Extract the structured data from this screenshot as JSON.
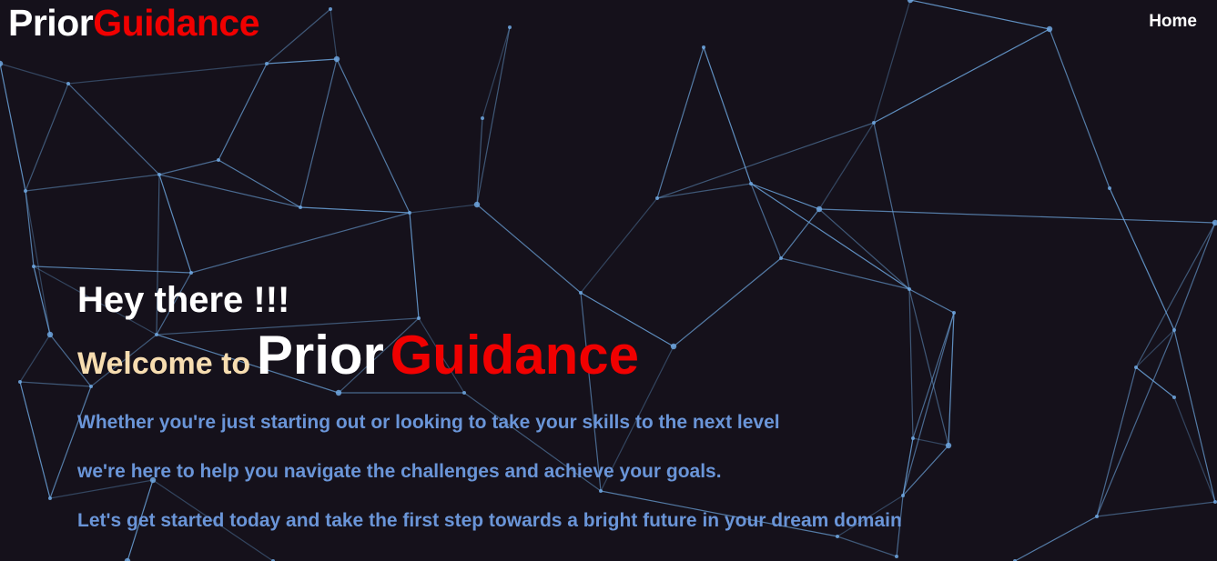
{
  "header": {
    "brand_part1": "Prior",
    "brand_part2": "Guidance",
    "nav": [
      {
        "label": "Home"
      }
    ]
  },
  "hero": {
    "greeting": "Hey there !!!",
    "welcome_prefix": "Welcome to",
    "brand_part1": "Prior",
    "brand_part2": "Guidance",
    "lines": [
      "Whether you're just starting out or looking to take your skills to the next level",
      "we're here to help you navigate the challenges and achieve your goals.",
      "Let's get started today and take the first step towards a bright future in your dream domain"
    ]
  },
  "colors": {
    "background": "#15111b",
    "brand_accent": "#f00000",
    "welcome_text": "#f7ddb0",
    "body_text": "#6a95d8",
    "network_line": "#6ea7e0"
  }
}
